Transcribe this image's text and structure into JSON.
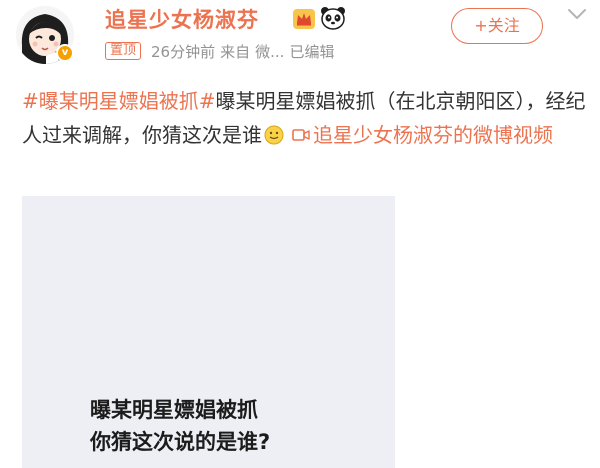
{
  "author": {
    "name": "追星少女杨淑芬",
    "avatar_icon": "anime-girl-avatar",
    "verified_badge": "v",
    "badge_icons": [
      "crown-icon",
      "panda-icon"
    ]
  },
  "meta": {
    "pinned_label": "置顶",
    "time": "26分钟前",
    "source_prefix": "来自",
    "source": "微...",
    "edited": "已编辑"
  },
  "follow_button": {
    "label": "+关注"
  },
  "post": {
    "topic": "#曝某明星嫖娼被抓#",
    "text": "曝某明星嫖娼被抓（在北京朝阳区），经纪人过来调解，你猜这次是谁",
    "emoji": "smile-emoji",
    "video_link_label": "追星少女杨淑芬的微博视频"
  },
  "video": {
    "caption_line1": "曝某明星嫖娼被抓",
    "caption_line2": "你猜这次说的是谁?",
    "background": "#eeeff5"
  },
  "colors": {
    "accent": "#eb7350",
    "text": "#333333",
    "muted": "#939393"
  }
}
